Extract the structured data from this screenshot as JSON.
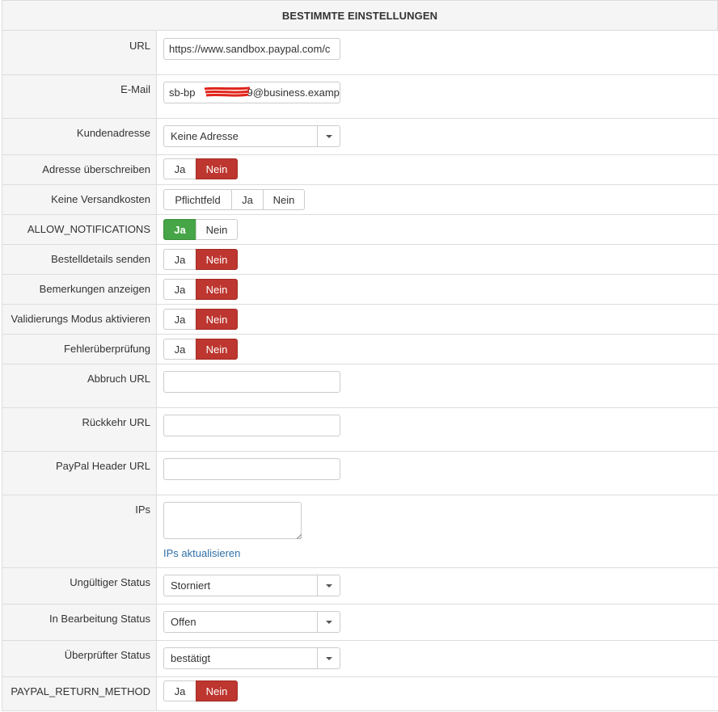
{
  "header": {
    "title": "BESTIMMTE EINSTELLUNGEN"
  },
  "fields": {
    "url": {
      "label": "URL",
      "value": "https://www.sandbox.paypal.com/c"
    },
    "email": {
      "label": "E-Mail",
      "value_prefix": "sb-bp",
      "value_suffix": "9@business.examp"
    },
    "customer_address": {
      "label": "Kundenadresse",
      "selected": "Keine Adresse"
    },
    "override_address": {
      "label": "Adresse überschreiben",
      "options": [
        "Ja",
        "Nein"
      ],
      "selected": "Nein"
    },
    "no_shipping": {
      "label": "Keine Versandkosten",
      "options": [
        "Pflichtfeld",
        "Ja",
        "Nein"
      ],
      "selected": ""
    },
    "allow_notifications": {
      "label": "ALLOW_NOTIFICATIONS",
      "options": [
        "Ja",
        "Nein"
      ],
      "selected": "Ja"
    },
    "send_order_details": {
      "label": "Bestelldetails senden",
      "options": [
        "Ja",
        "Nein"
      ],
      "selected": "Nein"
    },
    "show_remarks": {
      "label": "Bemerkungen anzeigen",
      "options": [
        "Ja",
        "Nein"
      ],
      "selected": "Nein"
    },
    "validation_mode": {
      "label": "Validierungs Modus aktivieren",
      "options": [
        "Ja",
        "Nein"
      ],
      "selected": "Nein"
    },
    "error_check": {
      "label": "Fehlerüberprüfung",
      "options": [
        "Ja",
        "Nein"
      ],
      "selected": "Nein"
    },
    "cancel_url": {
      "label": "Abbruch URL",
      "value": ""
    },
    "return_url": {
      "label": "Rückkehr URL",
      "value": ""
    },
    "header_url": {
      "label": "PayPal Header URL",
      "value": ""
    },
    "ips": {
      "label": "IPs",
      "value": "",
      "update_link": "IPs aktualisieren"
    },
    "invalid_status": {
      "label": "Ungültiger Status",
      "selected": "Storniert"
    },
    "processing_status": {
      "label": "In Bearbeitung Status",
      "selected": "Offen"
    },
    "verified_status": {
      "label": "Überprüfter Status",
      "selected": "bestätigt"
    },
    "return_method": {
      "label": "PAYPAL_RETURN_METHOD",
      "options": [
        "Ja",
        "Nein"
      ],
      "selected": "Nein"
    }
  },
  "colors": {
    "no_active": "#bd362f",
    "yes_active": "#46a546",
    "link": "#2f6fa7"
  }
}
